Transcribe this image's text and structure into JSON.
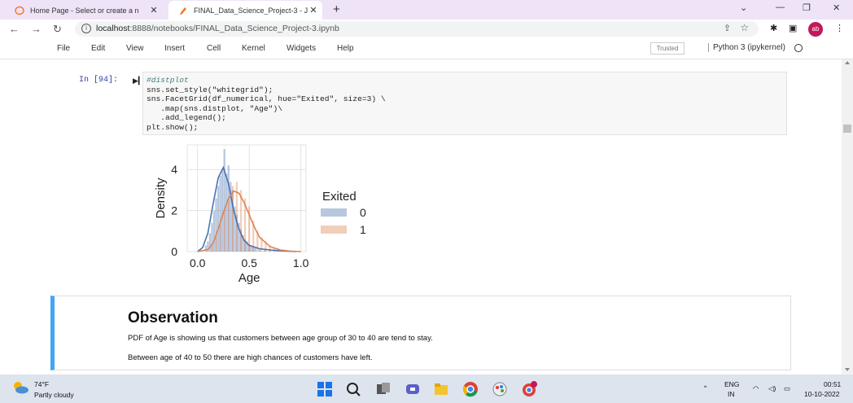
{
  "browser": {
    "tabs": [
      {
        "title": "Home Page - Select or create a n",
        "active": false
      },
      {
        "title": "FINAL_Data_Science_Project-3 - J",
        "active": true
      }
    ],
    "url_host": "localhost",
    "url_path": ":8888/notebooks/FINAL_Data_Science_Project-3.ipynb",
    "profile_initials": "ab"
  },
  "jupyter": {
    "menu": [
      "File",
      "Edit",
      "View",
      "Insert",
      "Cell",
      "Kernel",
      "Widgets",
      "Help"
    ],
    "trusted_label": "Trusted",
    "kernel_label": "Python 3 (ipykernel)"
  },
  "cell": {
    "prompt": "In [94]:",
    "code": [
      "#distplot",
      "sns.set_style(\"whitegrid\");",
      "sns.FacetGrid(df_numerical, hue=\"Exited\", size=3) \\",
      "   .map(sns.distplot, \"Age\")\\",
      "   .add_legend();",
      "plt.show();"
    ]
  },
  "chart_data": {
    "type": "histogram",
    "xlabel": "Age",
    "ylabel": "Density",
    "xlim": [
      -0.1,
      1.05
    ],
    "ylim": [
      0,
      5.2
    ],
    "xticks": [
      "0.0",
      "0.5",
      "1.0"
    ],
    "yticks": [
      "0",
      "2",
      "4"
    ],
    "legend_title": "Exited",
    "legend_position": "right",
    "grid": true,
    "colors": {
      "0": "#4c72b0",
      "1": "#dd8452"
    },
    "series": [
      {
        "name": "0",
        "bins_x": [
          0.08,
          0.1,
          0.12,
          0.14,
          0.16,
          0.18,
          0.2,
          0.22,
          0.24,
          0.26,
          0.28,
          0.3,
          0.32,
          0.34,
          0.36,
          0.38,
          0.4,
          0.42,
          0.44,
          0.46,
          0.48,
          0.5,
          0.52,
          0.54,
          0.56,
          0.6,
          0.65,
          0.7,
          0.75,
          0.8
        ],
        "bins_y": [
          0.3,
          0.5,
          0.9,
          1.4,
          2.0,
          2.6,
          3.2,
          3.7,
          4.0,
          5.0,
          3.8,
          4.2,
          3.4,
          3.0,
          2.2,
          1.8,
          1.4,
          1.1,
          0.8,
          0.6,
          0.5,
          0.35,
          0.3,
          0.25,
          0.2,
          0.15,
          0.12,
          0.1,
          0.08,
          0.05
        ],
        "kde_x": [
          0.0,
          0.05,
          0.1,
          0.15,
          0.2,
          0.25,
          0.3,
          0.35,
          0.4,
          0.45,
          0.5,
          0.6,
          0.7,
          0.8,
          0.9,
          0.95
        ],
        "kde_y": [
          0.0,
          0.2,
          0.9,
          2.3,
          3.6,
          4.1,
          3.3,
          2.0,
          1.1,
          0.55,
          0.3,
          0.14,
          0.08,
          0.04,
          0.01,
          0.0
        ]
      },
      {
        "name": "1",
        "bins_x": [
          0.14,
          0.18,
          0.22,
          0.26,
          0.3,
          0.34,
          0.38,
          0.42,
          0.46,
          0.5,
          0.54,
          0.58,
          0.62,
          0.66,
          0.7,
          0.74,
          0.78
        ],
        "bins_y": [
          0.4,
          0.8,
          1.4,
          2.0,
          2.6,
          3.2,
          3.4,
          3.0,
          2.6,
          2.2,
          1.5,
          1.0,
          0.7,
          0.5,
          0.3,
          0.2,
          0.1
        ],
        "kde_x": [
          0.0,
          0.1,
          0.15,
          0.2,
          0.25,
          0.3,
          0.35,
          0.4,
          0.45,
          0.5,
          0.55,
          0.6,
          0.7,
          0.8,
          0.9,
          1.0
        ],
        "kde_y": [
          0.0,
          0.1,
          0.4,
          1.1,
          1.9,
          2.6,
          2.95,
          2.85,
          2.4,
          1.8,
          1.2,
          0.7,
          0.25,
          0.08,
          0.02,
          0.0
        ]
      }
    ]
  },
  "observation": {
    "heading": "Observation",
    "line1": "PDF of Age is showing us that customers between age group of 30 to 40 are tend to stay.",
    "line2": "Between age of 40 to 50 there are high chances of customers have left."
  },
  "taskbar": {
    "temperature": "74°F",
    "condition": "Partly cloudy",
    "language": "ENG",
    "region": "IN",
    "time": "00:51",
    "date": "10-10-2022"
  }
}
